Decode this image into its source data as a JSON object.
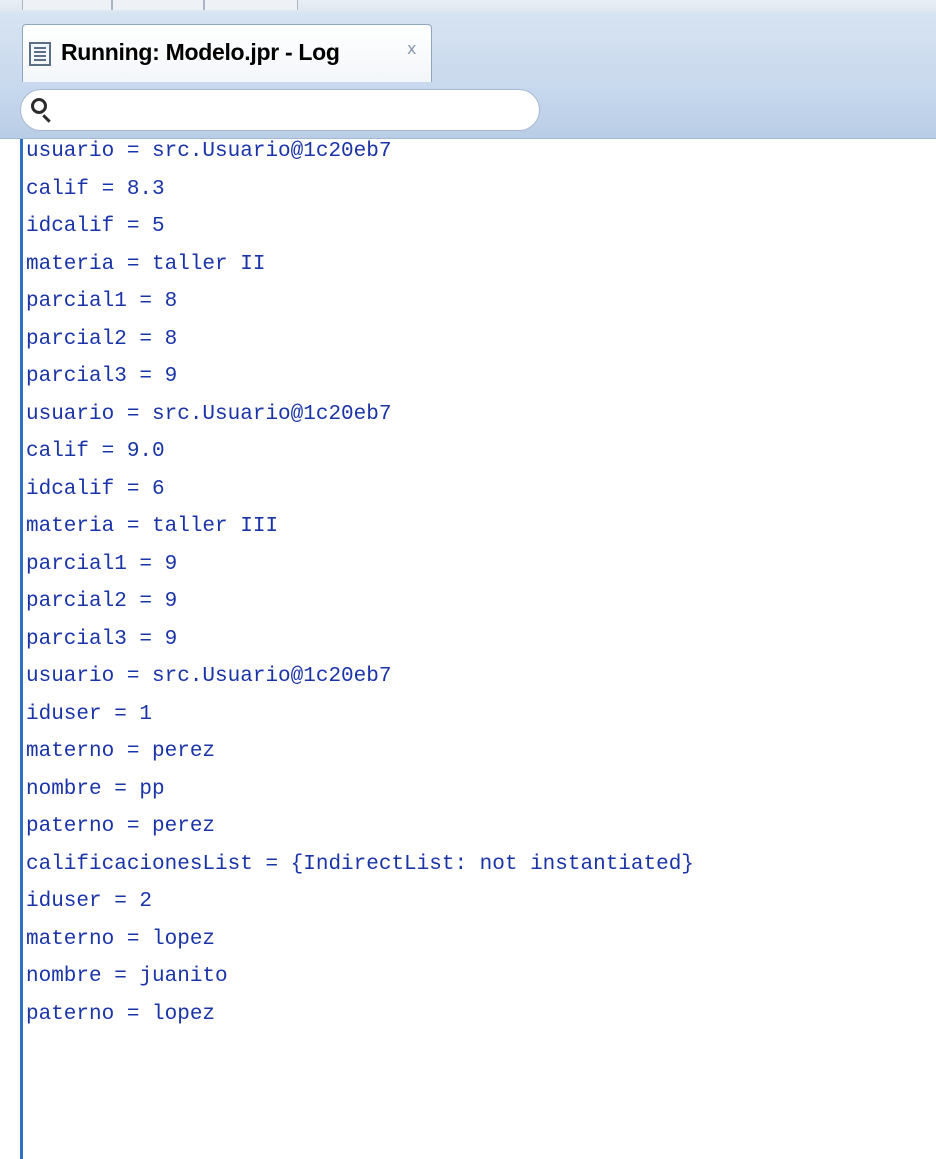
{
  "tab": {
    "title": "Running: Modelo.jpr - Log",
    "close_label": "x",
    "icon": "log-document-icon"
  },
  "search": {
    "placeholder": "",
    "value": "",
    "icon": "search-icon"
  },
  "colors": {
    "log_text": "#1a34a8",
    "tab_bar": "#c9d9ec",
    "left_rule": "#2e6fc5"
  },
  "log": {
    "lines": [
      "usuario = src.Usuario@1c20eb7",
      "calif = 8.3",
      "idcalif = 5",
      "materia = taller II",
      "parcial1 = 8",
      "parcial2 = 8",
      "parcial3 = 9",
      "usuario = src.Usuario@1c20eb7",
      "calif = 9.0",
      "idcalif = 6",
      "materia = taller III",
      "parcial1 = 9",
      "parcial2 = 9",
      "parcial3 = 9",
      "usuario = src.Usuario@1c20eb7",
      "iduser = 1",
      "materno = perez",
      "nombre = pp",
      "paterno = perez",
      "calificacionesList = {IndirectList: not instantiated}",
      "iduser = 2",
      "materno = lopez",
      "nombre = juanito",
      "paterno = lopez"
    ]
  }
}
